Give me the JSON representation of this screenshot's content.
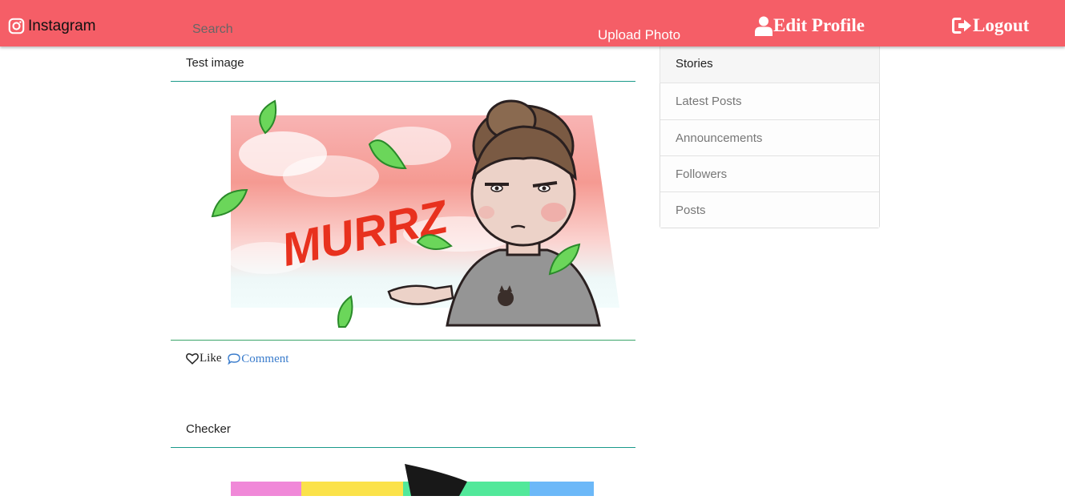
{
  "navbar": {
    "brand": "Instagram",
    "search_placeholder": "Search",
    "upload": "Upload Photo",
    "edit_profile": "Edit Profile",
    "logout": "Logout",
    "bg_color": "#f55e67",
    "brand_icon": "instagram-icon",
    "edit_icon": "user-icon",
    "logout_icon": "sign-out-icon"
  },
  "posts": [
    {
      "title": "Test image",
      "image_text": "MURRZ",
      "like": "Like",
      "comment": "Comment"
    },
    {
      "title": "Checker"
    }
  ],
  "sidebar": {
    "header": "Stories",
    "items": [
      "Latest Posts",
      "Announcements",
      "Followers",
      "Posts"
    ]
  },
  "colors": {
    "link": "#3a7ccc",
    "divider": "#1a9a8a"
  }
}
